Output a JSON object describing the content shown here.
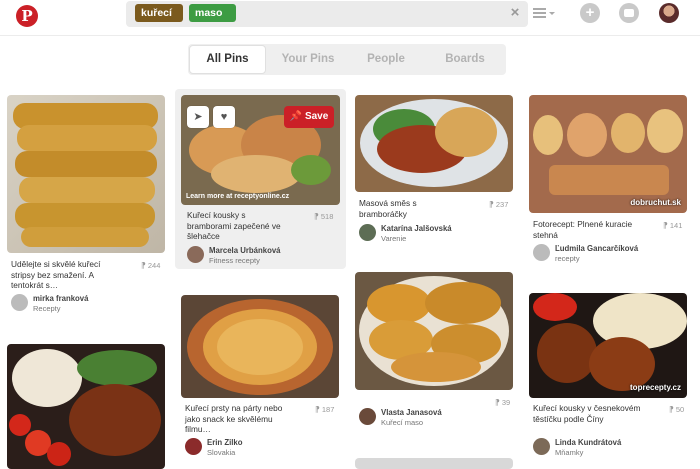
{
  "header": {
    "logo_text": "P",
    "search_chips": [
      {
        "label": "kuřecí",
        "remove": "×",
        "color": "#7b5a1d"
      },
      {
        "label": "maso",
        "remove": "×",
        "color": "#3d9c43"
      }
    ],
    "clear_symbol": "×",
    "add_symbol": "+"
  },
  "tabs": [
    {
      "label": "All Pins",
      "active": true
    },
    {
      "label": "Your Pins",
      "active": false
    },
    {
      "label": "People",
      "active": false
    },
    {
      "label": "Boards",
      "active": false
    }
  ],
  "pins": [
    {
      "description": "Udělejte si skvělé kuřecí stripsy bez smažení. A tentokrát s…",
      "repins": "244",
      "user": "mirka franková",
      "board": "Recepty"
    },
    {
      "description": "Kuřecí kousky s bramborami zapečené ve šlehačce",
      "repins": "518",
      "user": "Marcela Urbánková",
      "board": "Fitness recepty",
      "source": "Learn more at receptyonline.cz",
      "save_label": "Save"
    },
    {
      "description": "Masová směs s bramboráčky",
      "repins": "237",
      "user": "Katarína Jalšovská",
      "board": "Varenie"
    },
    {
      "description": "Fotorecept: Plnené kuracie stehná",
      "repins": "141",
      "user": "Ľudmila Gancarčíková",
      "board": "recepty",
      "watermark": "dobruchut.sk"
    },
    {
      "description": "",
      "repins": "",
      "user": "",
      "board": ""
    },
    {
      "description": "Kuřecí prsty na párty nebo jako snack ke skvělému filmu…",
      "repins": "187",
      "user": "Erin Zilko",
      "board": "Slovakia"
    },
    {
      "description": "",
      "repins": "39",
      "user": "Vlasta Janasová",
      "board": "Kuřecí maso"
    },
    {
      "description": "Kuřecí kousky v česnekovém těstíčku podle Číny",
      "repins": "50",
      "user": "Linda Kundrátová",
      "board": "Mňamky",
      "watermark": "toprecepty.cz"
    }
  ],
  "colors": {
    "brand": "#cb2027",
    "tab_bg": "#efefef"
  }
}
